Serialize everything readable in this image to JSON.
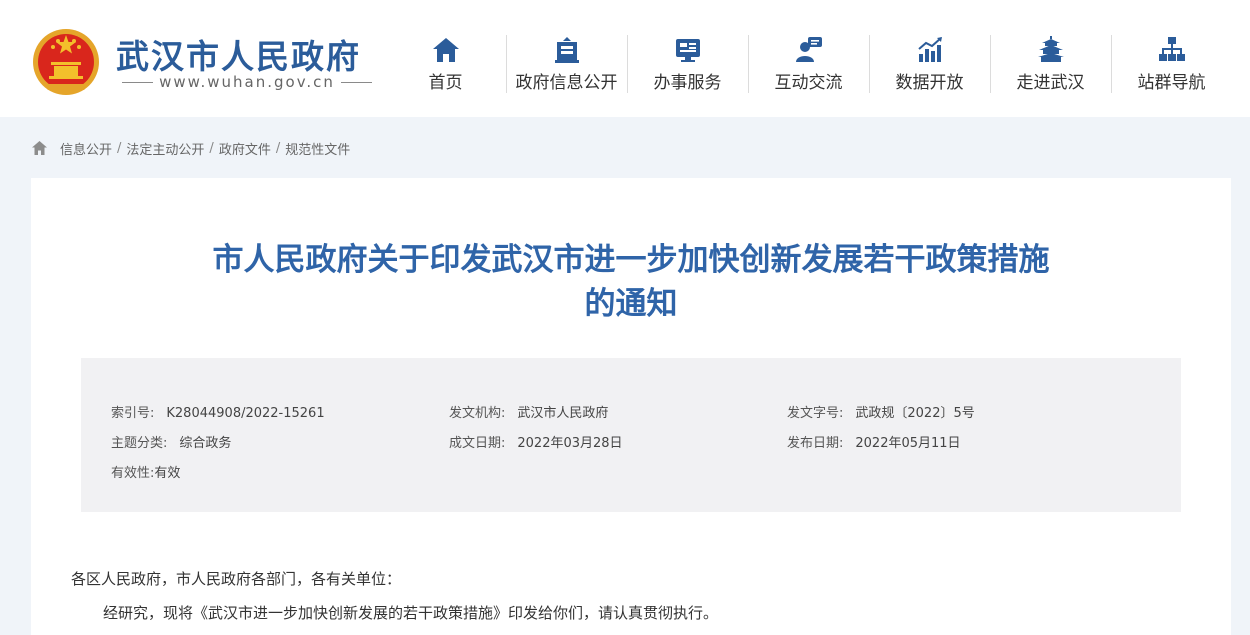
{
  "header": {
    "site_title": "武汉市人民政府",
    "site_url": "www.wuhan.gov.cn"
  },
  "nav": [
    {
      "label": "首页",
      "icon": "home-icon"
    },
    {
      "label": "政府信息公开",
      "icon": "building-icon"
    },
    {
      "label": "办事服务",
      "icon": "service-icon"
    },
    {
      "label": "互动交流",
      "icon": "chat-user-icon"
    },
    {
      "label": "数据开放",
      "icon": "chart-icon"
    },
    {
      "label": "走进武汉",
      "icon": "pavilion-icon"
    },
    {
      "label": "站群导航",
      "icon": "sitemap-icon"
    }
  ],
  "breadcrumb": [
    "信息公开",
    "法定主动公开",
    "政府文件",
    "规范性文件"
  ],
  "document": {
    "title_line1": "市人民政府关于印发武汉市进一步加快创新发展若干政策措施",
    "title_line2": "的通知",
    "meta": {
      "index_label": "索引号:",
      "index_value": "K28044908/2022-15261",
      "issuer_label": "发文机构:",
      "issuer_value": "武汉市人民政府",
      "docno_label": "发文字号:",
      "docno_value": "武政规〔2022〕5号",
      "category_label": "主题分类:",
      "category_value": "综合政务",
      "created_label": "成文日期:",
      "created_value": "2022年03月28日",
      "published_label": "发布日期:",
      "published_value": "2022年05月11日",
      "validity_label": "有效性:",
      "validity_value": "有效"
    },
    "salutation": "各区人民政府，市人民政府各部门，各有关单位：",
    "paragraph1": "经研究，现将《武汉市进一步加快创新发展的若干政策措施》印发给你们，请认真贯彻执行。"
  },
  "colors": {
    "brand_blue": "#2b5c9a",
    "title_blue": "#2f64a8",
    "emblem_red": "#d9261c",
    "emblem_gold": "#f3c02b"
  }
}
